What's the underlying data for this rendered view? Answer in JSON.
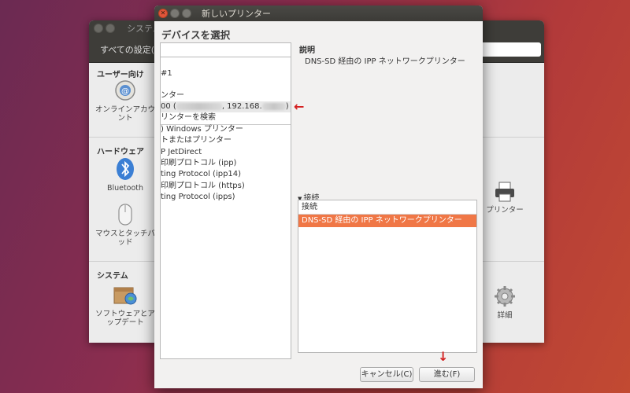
{
  "bg_window": {
    "title": "システム設",
    "toolbar_label": "すべての設定(A",
    "sections": [
      {
        "heading": "ユーザー向け",
        "items": [
          {
            "label": "オンラインアカウント",
            "icon": "online-accounts-icon"
          }
        ]
      },
      {
        "heading": "ハードウェア",
        "items": [
          {
            "label": "Bluetooth",
            "icon": "bluetooth-icon"
          },
          {
            "label": "マウスとタッチパッド",
            "icon": "mouse-icon"
          },
          {
            "label": "プリンター",
            "icon": "printer-icon"
          }
        ]
      },
      {
        "heading": "システム",
        "items": [
          {
            "label": "ソフトウェアとアップデート",
            "icon": "software-icon"
          },
          {
            "label": "詳細",
            "icon": "gear-icon"
          }
        ]
      }
    ]
  },
  "dialog": {
    "title": "新しいプリンター",
    "heading": "デバイスを選択",
    "search_placeholder": "",
    "devices": [
      {
        "text": "#1"
      },
      {
        "text": "ンター"
      },
      {
        "text_prefix": "00 (",
        "text_mid": ", 192.168.",
        "text_suffix": ")",
        "selected": true
      },
      {
        "text": "リンターを検索"
      },
      {
        "text": ") Windows プリンター"
      },
      {
        "text": "トまたはプリンター"
      },
      {
        "text": "P JetDirect"
      },
      {
        "text": "印刷プロトコル (ipp)"
      },
      {
        "text": "ting Protocol (ipp14)"
      },
      {
        "text": "印刷プロトコル (https)"
      },
      {
        "text": "ting Protocol (ipps)"
      }
    ],
    "description_label": "説明",
    "description_value": "DNS-SD 経由の IPP ネットワークプリンター",
    "connection_label": "接続",
    "connection_header": "接続",
    "connection_selected": "DNS-SD 経由の IPP ネットワークプリンター",
    "cancel_label": "キャンセル(C)",
    "forward_label": "進む(F)"
  },
  "annotations": {
    "arrow_left": "←",
    "arrow_down": "↓"
  },
  "colors": {
    "selection": "#f07746",
    "accent_close": "#e0553a",
    "annotation": "#d42020"
  }
}
